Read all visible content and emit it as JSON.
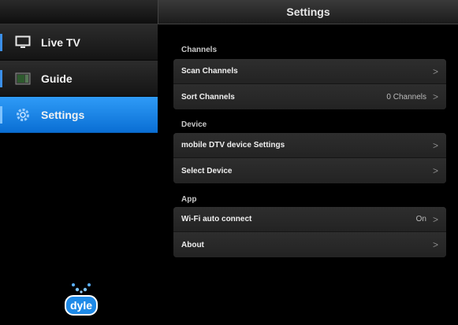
{
  "sidebar": {
    "items": [
      {
        "label": "Live TV",
        "icon": "tv-icon",
        "active": false
      },
      {
        "label": "Guide",
        "icon": "guide-icon",
        "active": false
      },
      {
        "label": "Settings",
        "icon": "gear-icon",
        "active": true
      }
    ],
    "logo_text": "dyle"
  },
  "header": {
    "title": "Settings"
  },
  "sections": [
    {
      "title": "Channels",
      "rows": [
        {
          "label": "Scan Channels",
          "value": ""
        },
        {
          "label": "Sort Channels",
          "value": "0 Channels"
        }
      ]
    },
    {
      "title": "Device",
      "rows": [
        {
          "label": "mobile DTV device Settings",
          "value": ""
        },
        {
          "label": "Select Device",
          "value": ""
        }
      ]
    },
    {
      "title": "App",
      "rows": [
        {
          "label": "Wi-Fi auto connect",
          "value": "On"
        },
        {
          "label": "About",
          "value": ""
        }
      ]
    }
  ],
  "colors": {
    "accent": "#1f86ea",
    "background": "#000000",
    "row": "#2a2a2a"
  },
  "chevron": ">"
}
